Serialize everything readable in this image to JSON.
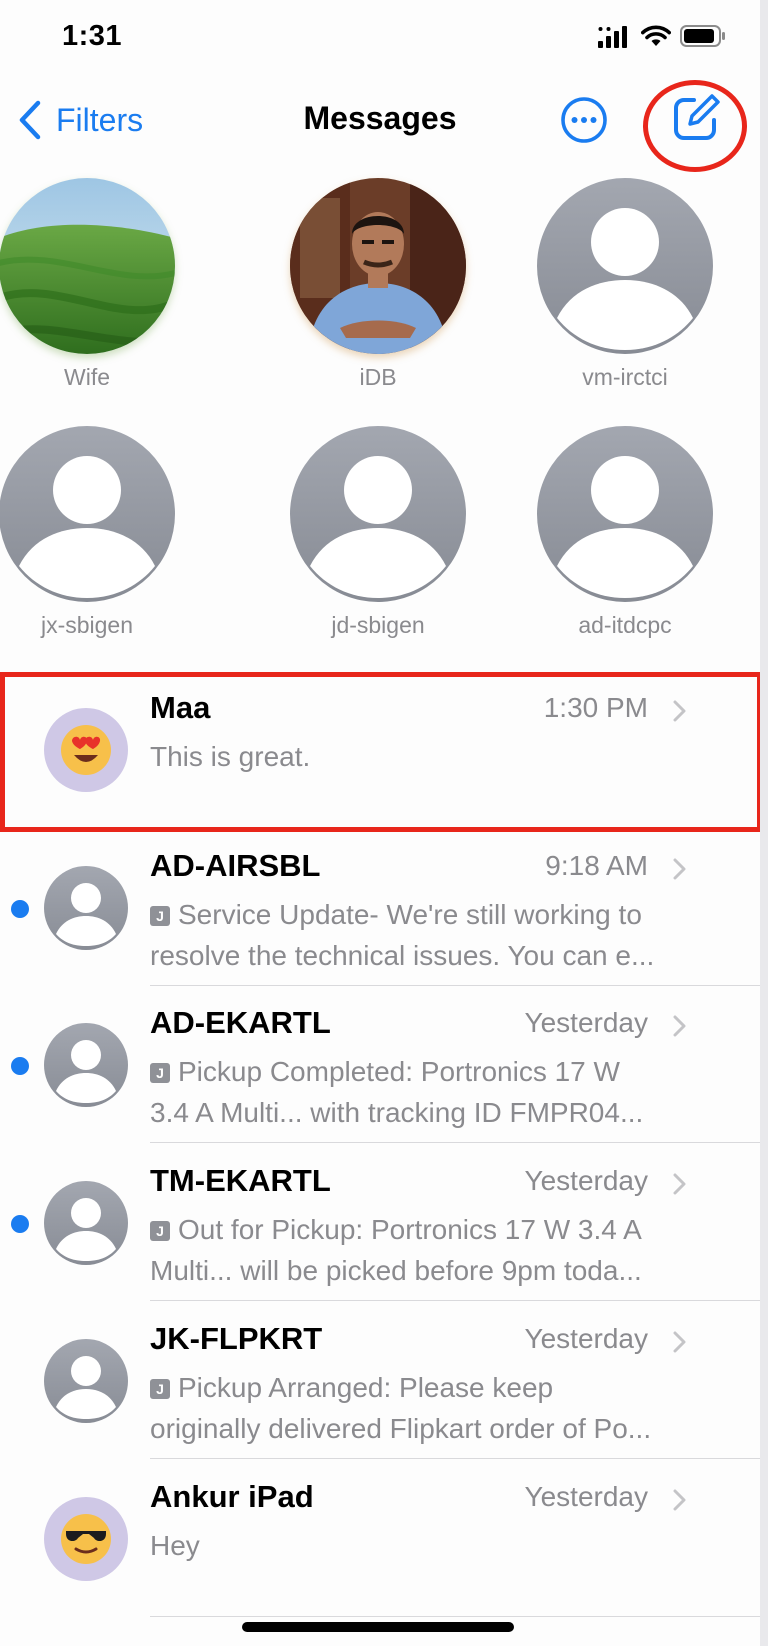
{
  "status_bar": {
    "time": "1:31"
  },
  "nav": {
    "back_label": "Filters",
    "title": "Messages"
  },
  "pinned": [
    {
      "name": "Wife",
      "avatar": "landscape-photo"
    },
    {
      "name": "iDB",
      "avatar": "person-photo"
    },
    {
      "name": "vm-irctci",
      "avatar": "default-person-icon"
    },
    {
      "name": "jx-sbigen",
      "avatar": "default-person-icon"
    },
    {
      "name": "jd-sbigen",
      "avatar": "default-person-icon"
    },
    {
      "name": "ad-itdcpc",
      "avatar": "default-person-icon"
    }
  ],
  "conversations": [
    {
      "sender": "Maa",
      "time": "1:30 PM",
      "unread": false,
      "avatar": "heart-eyes-emoji",
      "preview": [
        "This is great."
      ],
      "badge": false
    },
    {
      "sender": "AD-AIRSBL",
      "time": "9:18 AM",
      "unread": true,
      "avatar": "default-person-icon",
      "badge": true,
      "badge_letter": "J",
      "preview": [
        "Service Update- We're still working to",
        "resolve the technical issues. You can e..."
      ]
    },
    {
      "sender": "AD-EKARTL",
      "time": "Yesterday",
      "unread": true,
      "avatar": "default-person-icon",
      "badge": true,
      "badge_letter": "J",
      "preview": [
        "Pickup Completed: Portronics 17 W",
        "3.4 A Multi... with tracking ID FMPR04..."
      ]
    },
    {
      "sender": "TM-EKARTL",
      "time": "Yesterday",
      "unread": true,
      "avatar": "default-person-icon",
      "badge": true,
      "badge_letter": "J",
      "preview": [
        "Out for Pickup: Portronics 17 W 3.4 A",
        "Multi... will be picked before 9pm toda..."
      ]
    },
    {
      "sender": "JK-FLPKRT",
      "time": "Yesterday",
      "unread": false,
      "avatar": "default-person-icon",
      "badge": true,
      "badge_letter": "J",
      "preview": [
        "Pickup Arranged: Please keep",
        "originally delivered Flipkart order of Po..."
      ]
    },
    {
      "sender": "Ankur iPad",
      "time": "Yesterday",
      "unread": false,
      "avatar": "sunglasses-emoji",
      "badge": false,
      "preview": [
        "Hey"
      ]
    }
  ],
  "colors": {
    "accent": "#1a7cf0",
    "highlight": "#e8261b",
    "unread_dot": "#1a7cf0",
    "secondary_text": "#8a8a8e"
  }
}
